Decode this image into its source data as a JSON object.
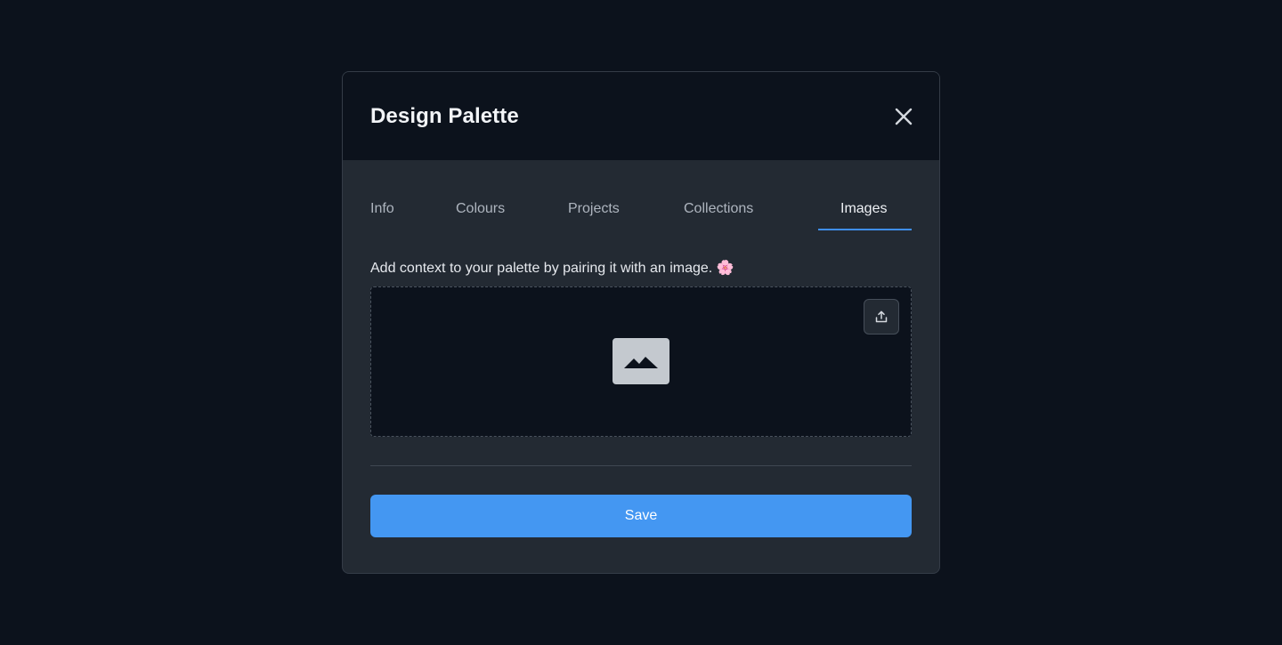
{
  "modal": {
    "title": "Design Palette"
  },
  "tabs": [
    {
      "label": "Info",
      "active": false
    },
    {
      "label": "Colours",
      "active": false
    },
    {
      "label": "Projects",
      "active": false
    },
    {
      "label": "Collections",
      "active": false
    },
    {
      "label": "Images",
      "active": true
    }
  ],
  "images_panel": {
    "description": "Add context to your palette by pairing it with an image. 🌸"
  },
  "footer": {
    "save_label": "Save"
  },
  "icons": {
    "close": "close-icon",
    "upload": "upload-icon",
    "image_placeholder": "image-icon"
  },
  "colors": {
    "accent": "#4497f2",
    "background": "#0c121c",
    "panel": "#232a33"
  }
}
